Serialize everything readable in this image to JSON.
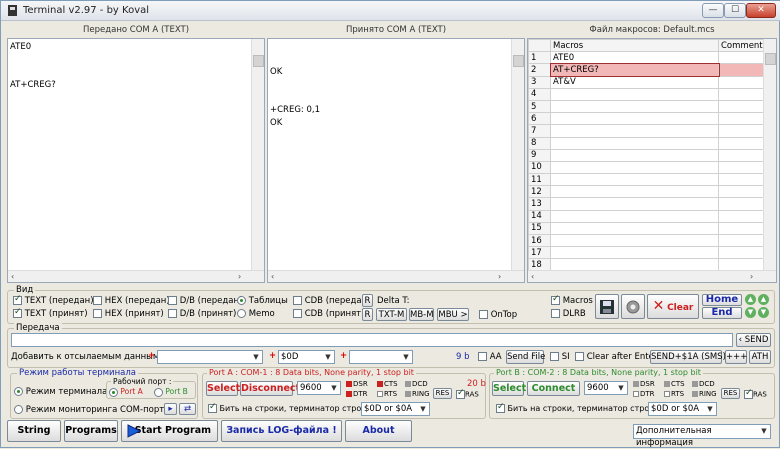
{
  "window": {
    "title": "Terminal  v2.97 - by Koval",
    "min": "—",
    "max": "☐",
    "close": "✕"
  },
  "panels": {
    "sent_title": "Передано COM A (TEXT)",
    "recv_title": "Принято COM A (TEXT)",
    "macro_title": "Файл макросов: Default.mcs",
    "sent_lines": "ATE0\n\n\nAT+CREG?",
    "recv_lines": "\n\nOK\n\n\n+CREG: 0,1\nOK"
  },
  "macros": {
    "col_macros": "Macros",
    "col_comments": "Comments",
    "rows": [
      {
        "n": "1",
        "m": "ATE0"
      },
      {
        "n": "2",
        "m": "AT+CREG?"
      },
      {
        "n": "3",
        "m": "AT&V"
      },
      {
        "n": "4",
        "m": ""
      },
      {
        "n": "5",
        "m": ""
      },
      {
        "n": "6",
        "m": ""
      },
      {
        "n": "7",
        "m": ""
      },
      {
        "n": "8",
        "m": ""
      },
      {
        "n": "9",
        "m": ""
      },
      {
        "n": "10",
        "m": ""
      },
      {
        "n": "11",
        "m": ""
      },
      {
        "n": "12",
        "m": ""
      },
      {
        "n": "13",
        "m": ""
      },
      {
        "n": "14",
        "m": ""
      },
      {
        "n": "15",
        "m": ""
      },
      {
        "n": "16",
        "m": ""
      },
      {
        "n": "17",
        "m": ""
      },
      {
        "n": "18",
        "m": ""
      }
    ]
  },
  "view": {
    "group_title": "Вид",
    "text_sent": "TEXT (передан)",
    "text_recv": "TEXT (принят)",
    "hex_sent": "HEX (передан)",
    "hex_recv": "HEX (принят)",
    "db_sent": "D/B (передан)",
    "db_recv": "D/B (принят)",
    "tables": "Таблицы",
    "memo": "Memo",
    "cdb_sent": "CDB (передан)",
    "cdb_recv": "CDB (принят)",
    "r": "R",
    "delta": "Delta T:",
    "txt_m": "TXT-M",
    "mb_m": "MB-M",
    "mbu": "MBU >",
    "ontop": "OnTop",
    "macros": "Macros",
    "dlrb": "DLRB",
    "clear": "Clear",
    "home": "Home",
    "end": "End"
  },
  "send": {
    "group_title": "Передача",
    "send_btn": "‹ SEND",
    "add_label": "Добавить к отсылаемым данным:",
    "combo2": "$0D",
    "bytes": "9 b",
    "aa": "AA",
    "send_file": "Send File",
    "si": "SI",
    "clear_after": "Clear after Enter",
    "sms": "SEND+$1A (SMS)",
    "plus3": "+++",
    "ath": "ATH"
  },
  "mode": {
    "group_title": "Режим работы терминала",
    "terminal": "Режим терминала",
    "monitor": "Режим мониторинга COM-портов",
    "work_port": "Рабочий порт :",
    "port_a": "Port A",
    "port_b": "Port B"
  },
  "portA": {
    "title": "Port A : COM-1 : 8 Data bits, None parity, 1 stop bit",
    "select": "Select",
    "connect": "Disconnect",
    "baud": "9600",
    "dsr": "DSR",
    "cts": "CTS",
    "dcd": "DCD",
    "dtr": "DTR",
    "rts": "RTS",
    "ring": "RING",
    "res": "RES",
    "ras": "RAS",
    "bytes": "20 b",
    "split": "Бить на строки, терминатор строки:",
    "term": "$0D or $0A"
  },
  "portB": {
    "title": "Port B : COM-2 : 8 Data bits, None parity, 1 stop bit",
    "select": "Select",
    "connect": "Connect",
    "baud": "9600",
    "dsr": "DSR",
    "cts": "CTS",
    "dcd": "DCD",
    "dtr": "DTR",
    "rts": "RTS",
    "ring": "RING",
    "res": "RES",
    "ras": "RAS",
    "split": "Бить на строки, терминатор строки:",
    "term": "$0D or $0A"
  },
  "bottom": {
    "string": "String",
    "programs": "Programs",
    "start": "Start Program",
    "log": "Запись LOG-файла !",
    "about": "About",
    "info": "Дополнительная информация"
  },
  "colors": {
    "accent_red": "#cc1f1f",
    "accent_green": "#2e8b2e",
    "accent_blue": "#1a2aa8",
    "selection": "#f2b7b7"
  }
}
